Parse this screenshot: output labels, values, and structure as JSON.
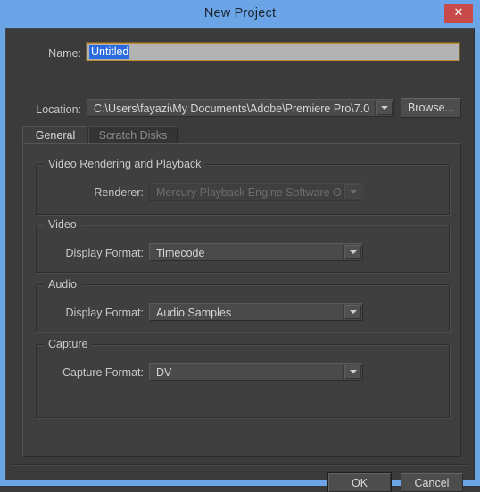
{
  "window": {
    "title": "New Project",
    "close_label": "✕",
    "accent_blue": "#6ba5e7",
    "body_bg": "#3b3b3b"
  },
  "form": {
    "name_label": "Name:",
    "name_value": "Untitled",
    "name_placeholder": "Untitled",
    "location_label": "Location:",
    "location_value": "C:\\Users\\fayazi\\My Documents\\Adobe\\Premiere Pro\\7.0",
    "browse_label": "Browse..."
  },
  "tabs": [
    {
      "label": "General",
      "active": true
    },
    {
      "label": "Scratch Disks",
      "active": false
    }
  ],
  "general": {
    "render_group": {
      "title": "Video Rendering and Playback",
      "renderer_label": "Renderer:",
      "renderer_value": "Mercury Playback Engine Software Only",
      "renderer_disabled": true
    },
    "video_group": {
      "title": "Video",
      "display_format_label": "Display Format:",
      "display_format_value": "Timecode"
    },
    "audio_group": {
      "title": "Audio",
      "display_format_label": "Display Format:",
      "display_format_value": "Audio Samples"
    },
    "capture_group": {
      "title": "Capture",
      "capture_format_label": "Capture Format:",
      "capture_format_value": "DV"
    }
  },
  "footer": {
    "ok_label": "OK",
    "cancel_label": "Cancel"
  }
}
